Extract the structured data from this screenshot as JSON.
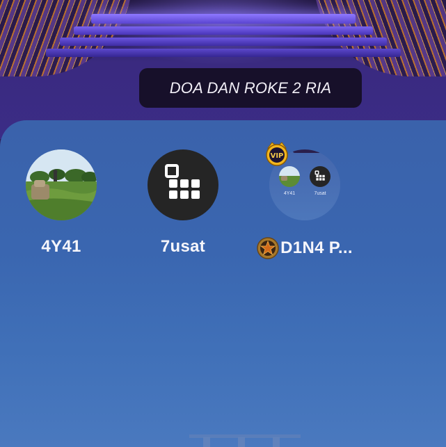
{
  "room": {
    "title": "DOA DAN ROKE 2 RIA"
  },
  "seats": [
    {
      "name": "4Y41",
      "avatar": "landscape-photo"
    },
    {
      "name": "7usat",
      "avatar": "grid-app-icon"
    },
    {
      "name": "D1N4 P...",
      "avatar": "room-preview",
      "badge": "star-medal-icon",
      "avatar_badge": "vip-crown-icon",
      "preview": {
        "seats": [
          {
            "name": "4Y41"
          },
          {
            "name": "7usat"
          }
        ]
      }
    }
  ],
  "colors": {
    "panel": "#3a62ab",
    "title_pill": "#120c1e",
    "stage_glow": "#8e78ff"
  }
}
